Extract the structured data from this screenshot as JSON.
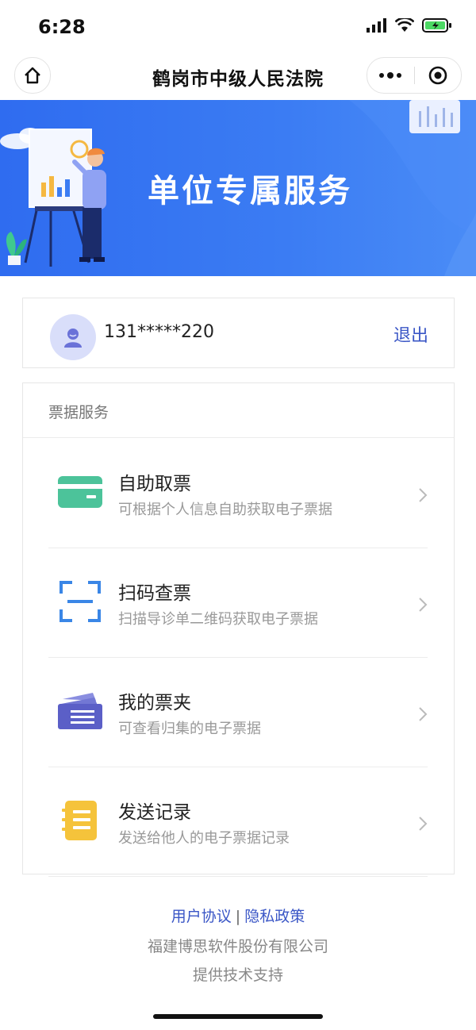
{
  "status_bar": {
    "time": "6:28"
  },
  "nav": {
    "title": "鹤岗市中级人民法院"
  },
  "banner": {
    "title": "单位专属服务"
  },
  "user": {
    "phone": "131*****220",
    "logout_label": "退出"
  },
  "services": {
    "section_title": "票据服务",
    "items": [
      {
        "title": "自助取票",
        "subtitle": "可根据个人信息自助获取电子票据",
        "icon": "card-icon",
        "color": "#4cc39a"
      },
      {
        "title": "扫码查票",
        "subtitle": "扫描导诊单二维码获取电子票据",
        "icon": "scan-icon",
        "color": "#3a86e6"
      },
      {
        "title": "我的票夹",
        "subtitle": "可查看归集的电子票据",
        "icon": "ticket-folder-icon",
        "color": "#5b5fc7"
      },
      {
        "title": "发送记录",
        "subtitle": "发送给他人的电子票据记录",
        "icon": "record-icon",
        "color": "#f5c33b"
      }
    ]
  },
  "footer": {
    "user_agreement": "用户协议",
    "separator": "|",
    "privacy_policy": "隐私政策",
    "company": "福建博思软件股份有限公司",
    "support": "提供技术支持"
  }
}
